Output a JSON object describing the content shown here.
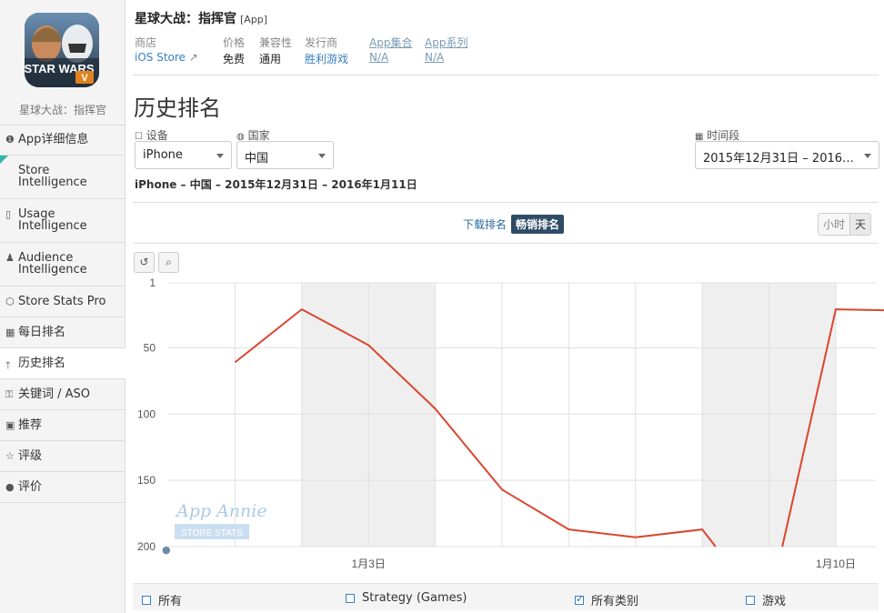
{
  "app": {
    "name": "星球大战：指挥官",
    "tag": "[App]",
    "icon_text": "STAR WARS",
    "icon_badge": "V"
  },
  "meta": {
    "store_label": "商店",
    "store_value": "iOS Store",
    "price_label": "价格",
    "price_value": "免费",
    "compat_label": "兼容性",
    "compat_value": "通用",
    "publisher_label": "发行商",
    "publisher_value": "胜利游戏",
    "collection_label": "App集合",
    "collection_value": "N/A",
    "series_label": "App系列",
    "series_value": "N/A"
  },
  "sidebar": {
    "items": [
      {
        "icon": "info-icon",
        "glyph": "❶",
        "label": "App详细信息"
      },
      {
        "icon": "store-icon",
        "glyph": "",
        "label": "Store\nIntelligence"
      },
      {
        "icon": "phone-icon",
        "glyph": "▯",
        "label": "Usage\nIntelligence"
      },
      {
        "icon": "person-icon",
        "glyph": "♟",
        "label": "Audience\nIntelligence"
      },
      {
        "icon": "hexagon-icon",
        "glyph": "⬡",
        "label": "Store Stats Pro"
      },
      {
        "icon": "calendar-icon",
        "glyph": "▦",
        "label": "每日排名"
      },
      {
        "icon": "arrow-up-icon",
        "glyph": "🡑",
        "label": "历史排名"
      },
      {
        "icon": "key-icon",
        "glyph": "⚿",
        "label": "关键词 / ASO"
      },
      {
        "icon": "bookmark-icon",
        "glyph": "▣",
        "label": "推荐"
      },
      {
        "icon": "star-icon",
        "glyph": "☆",
        "label": "评级"
      },
      {
        "icon": "comment-icon",
        "glyph": "●",
        "label": "评价"
      }
    ]
  },
  "page": {
    "title": "历史排名",
    "device_label": "设备",
    "device_value": "iPhone",
    "country_label": "国家",
    "country_value": "中国",
    "period_label": "时间段",
    "period_value": "2015年12月31日 – 2016…",
    "subtitle": "iPhone – 中国 – 2015年12月31日 – 2016年1月11日",
    "tab_downloads": "下载排名",
    "tab_grossing": "畅销排名",
    "period_hour": "小时",
    "period_day": "天"
  },
  "colors": {
    "line": "#d9462f",
    "link": "#3a80c3",
    "active_tab": "#2e4c66"
  },
  "watermark": {
    "line1": "App Annie",
    "line2": "STORE STATS"
  },
  "legend": [
    {
      "label": "所有",
      "checked": false
    },
    {
      "label": "Strategy (Games)",
      "checked": false
    },
    {
      "label": "所有类别",
      "checked": true
    },
    {
      "label": "游戏",
      "checked": false
    }
  ],
  "chart_data": {
    "type": "line",
    "y_reversed": true,
    "ylim": [
      1,
      200
    ],
    "yticks": [
      1,
      50,
      100,
      150,
      200
    ],
    "xlim": [
      0,
      10.6
    ],
    "xticks": [
      {
        "x": 3,
        "label": "1月3日"
      },
      {
        "x": 10,
        "label": "1月10日"
      }
    ],
    "series": [
      {
        "segments": [
          [
            [
              1,
              61
            ],
            [
              2,
              21
            ],
            [
              3,
              48
            ],
            [
              4,
              96
            ],
            [
              5,
              157
            ],
            [
              6,
              187
            ],
            [
              7,
              193
            ],
            [
              8,
              187
            ],
            [
              8.2,
              200
            ]
          ],
          [
            [
              9.2,
              200
            ],
            [
              10,
              21
            ],
            [
              11,
              22
            ]
          ]
        ]
      }
    ]
  }
}
